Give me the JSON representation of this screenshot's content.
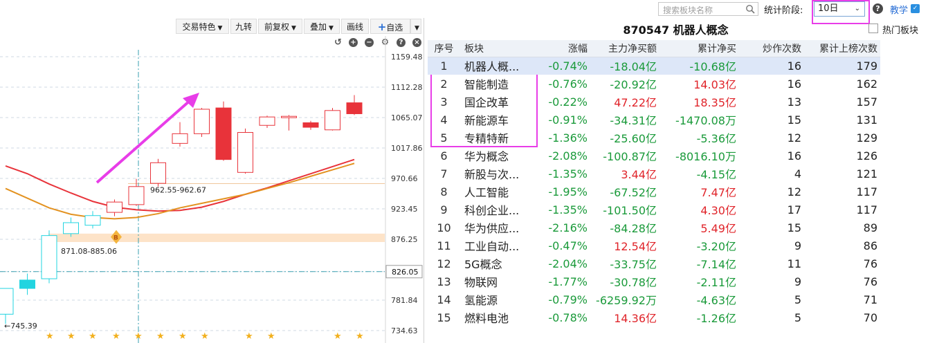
{
  "search": {
    "placeholder": "搜索板块名称"
  },
  "header": {
    "stat_label": "统计阶段:",
    "period_value": "10日",
    "help_icon": "?",
    "teach_label": "教学"
  },
  "toolbar": {
    "trade_feature": "交易特色",
    "nine_turn": "九转",
    "fq": "前复权",
    "overlay": "叠加",
    "draw_line": "画线",
    "watchlist": "自选"
  },
  "chart_icons": [
    "refresh-icon",
    "zoom-in-icon",
    "zoom-out-icon",
    "settings-icon",
    "help-icon",
    "close-icon"
  ],
  "chart_data": {
    "type": "candlestick",
    "y_ticks": [
      "1159.48",
      "1112.28",
      "1065.07",
      "1017.86",
      "970.66",
      "923.45",
      "876.25",
      "826.05",
      "781.84",
      "734.63"
    ],
    "ylim": [
      734.63,
      1159.48
    ],
    "current_price": "826.05",
    "annotations": {
      "range_upper": "962.55-962.67",
      "range_lower": "871.08-885.06",
      "low_label": "745.39",
      "buy_marker": "B"
    },
    "candles": [
      {
        "o": 800,
        "c": 760,
        "h": 800,
        "l": 745,
        "up": true
      },
      {
        "o": 813,
        "c": 800,
        "h": 823,
        "l": 790,
        "up": true
      },
      {
        "o": 815,
        "c": 882,
        "h": 890,
        "l": 808,
        "up": true
      },
      {
        "o": 902,
        "c": 885,
        "h": 910,
        "l": 880,
        "up": true
      },
      {
        "o": 913,
        "c": 898,
        "h": 920,
        "l": 893,
        "up": true
      },
      {
        "o": 918,
        "c": 934,
        "h": 938,
        "l": 912,
        "up": false
      },
      {
        "o": 930,
        "c": 958,
        "h": 970,
        "l": 928,
        "up": false
      },
      {
        "o": 963,
        "c": 995,
        "h": 1001,
        "l": 958,
        "up": false
      },
      {
        "o": 1040,
        "c": 1025,
        "h": 1058,
        "l": 1020,
        "up": false
      },
      {
        "o": 1040,
        "c": 1078,
        "h": 1080,
        "l": 1035,
        "up": false
      },
      {
        "o": 1080,
        "c": 1000,
        "h": 1090,
        "l": 998,
        "up": false,
        "filled": true
      },
      {
        "o": 1042,
        "c": 980,
        "h": 1048,
        "l": 978,
        "up": false
      },
      {
        "o": 1066,
        "c": 1053,
        "h": 1068,
        "l": 1049,
        "up": false
      },
      {
        "o": 1067,
        "c": 1066,
        "h": 1069,
        "l": 1045,
        "up": false
      },
      {
        "o": 1057,
        "c": 1050,
        "h": 1060,
        "l": 1046,
        "up": false,
        "filled": true
      },
      {
        "o": 1076,
        "c": 1046,
        "h": 1080,
        "l": 1045,
        "up": false
      },
      {
        "o": 1071,
        "c": 1088,
        "h": 1100,
        "l": 1069,
        "up": false,
        "filled": true
      }
    ],
    "ma_red": [
      990,
      978,
      962,
      948,
      935,
      926,
      922,
      920,
      921,
      926,
      935,
      946,
      956,
      967,
      978,
      989,
      1000
    ],
    "ma_orange": [
      955,
      940,
      925,
      915,
      910,
      908,
      910,
      916,
      925,
      932,
      939,
      946,
      955,
      964,
      974,
      984,
      994
    ],
    "star_count": 12
  },
  "panel": {
    "title": "870547  机器人概念",
    "hot_label": "热门板块"
  },
  "table": {
    "headers": [
      "序号",
      "板块",
      "涨幅",
      "主力净买额",
      "累计净买",
      "炒作次数",
      "累计上榜次数"
    ],
    "rows": [
      {
        "no": "1",
        "name": "机器人概...",
        "pct": "-0.74%",
        "net": "-18.04亿",
        "net_color": "g",
        "cum": "-10.68亿",
        "cum_color": "g",
        "times": "16",
        "rank": "179"
      },
      {
        "no": "2",
        "name": "智能制造",
        "pct": "-0.76%",
        "net": "-20.92亿",
        "net_color": "g",
        "cum": "14.03亿",
        "cum_color": "r",
        "times": "16",
        "rank": "162"
      },
      {
        "no": "3",
        "name": "国企改革",
        "pct": "-0.22%",
        "net": "47.22亿",
        "net_color": "r",
        "cum": "18.35亿",
        "cum_color": "r",
        "times": "13",
        "rank": "157"
      },
      {
        "no": "4",
        "name": "新能源车",
        "pct": "-0.91%",
        "net": "-34.31亿",
        "net_color": "g",
        "cum": "-1470.08万",
        "cum_color": "g",
        "times": "15",
        "rank": "131"
      },
      {
        "no": "5",
        "name": "专精特新",
        "pct": "-1.36%",
        "net": "-25.60亿",
        "net_color": "g",
        "cum": "-5.36亿",
        "cum_color": "g",
        "times": "12",
        "rank": "129"
      },
      {
        "no": "6",
        "name": "华为概念",
        "pct": "-2.08%",
        "net": "-100.87亿",
        "net_color": "g",
        "cum": "-8016.10万",
        "cum_color": "g",
        "times": "16",
        "rank": "126"
      },
      {
        "no": "7",
        "name": "新股与次...",
        "pct": "-1.35%",
        "net": "3.44亿",
        "net_color": "r",
        "cum": "-4.15亿",
        "cum_color": "g",
        "times": "4",
        "rank": "121"
      },
      {
        "no": "8",
        "name": "人工智能",
        "pct": "-1.95%",
        "net": "-67.52亿",
        "net_color": "g",
        "cum": "7.47亿",
        "cum_color": "r",
        "times": "12",
        "rank": "117"
      },
      {
        "no": "9",
        "name": "科创企业...",
        "pct": "-1.35%",
        "net": "-101.50亿",
        "net_color": "g",
        "cum": "4.30亿",
        "cum_color": "r",
        "times": "17",
        "rank": "117"
      },
      {
        "no": "10",
        "name": "华为供应...",
        "pct": "-2.16%",
        "net": "-84.28亿",
        "net_color": "g",
        "cum": "5.49亿",
        "cum_color": "r",
        "times": "15",
        "rank": "89"
      },
      {
        "no": "11",
        "name": "工业自动...",
        "pct": "-0.47%",
        "net": "12.54亿",
        "net_color": "r",
        "cum": "-3.20亿",
        "cum_color": "g",
        "times": "9",
        "rank": "86"
      },
      {
        "no": "12",
        "name": "5G概念",
        "pct": "-2.04%",
        "net": "-33.75亿",
        "net_color": "g",
        "cum": "-7.14亿",
        "cum_color": "g",
        "times": "11",
        "rank": "76"
      },
      {
        "no": "13",
        "name": "物联网",
        "pct": "-1.77%",
        "net": "-30.78亿",
        "net_color": "g",
        "cum": "-2.11亿",
        "cum_color": "g",
        "times": "9",
        "rank": "76"
      },
      {
        "no": "14",
        "name": "氢能源",
        "pct": "-0.79%",
        "net": "-6259.92万",
        "net_color": "g",
        "cum": "-4.63亿",
        "cum_color": "g",
        "times": "5",
        "rank": "71"
      },
      {
        "no": "15",
        "name": "燃料电池",
        "pct": "-0.78%",
        "net": "14.36亿",
        "net_color": "r",
        "cum": "-1.26亿",
        "cum_color": "g",
        "times": "5",
        "rank": "70"
      }
    ]
  },
  "colors": {
    "up": "#e0242a",
    "down": "#1a9a3a",
    "highlight": "#e83de8",
    "accent": "#2a6fd6"
  }
}
